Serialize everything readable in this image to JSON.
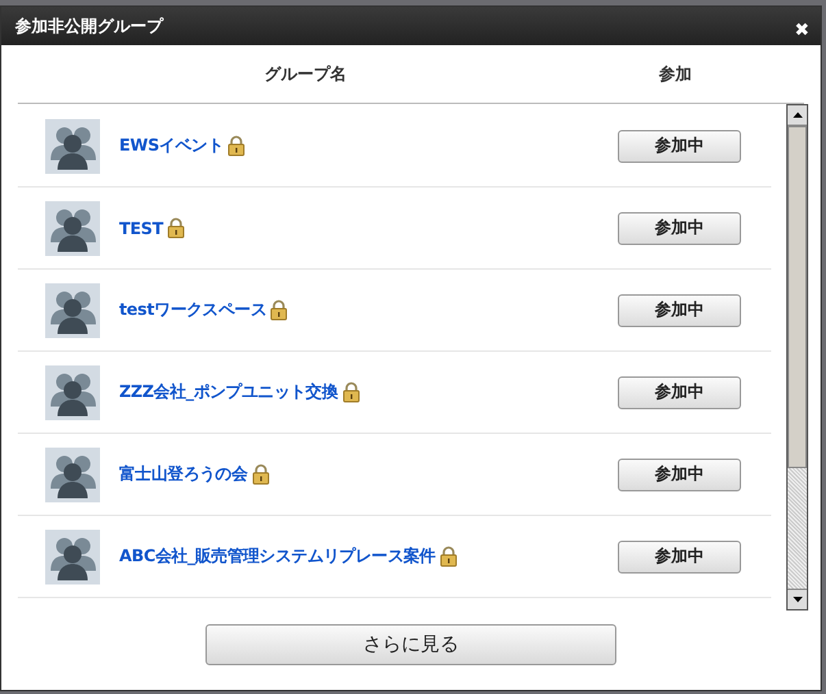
{
  "dialog": {
    "title": "参加非公開グループ",
    "close": "✖"
  },
  "columns": [
    "グループ名",
    "参加"
  ],
  "groups": [
    {
      "name": "EWSイベント",
      "locked": true,
      "button": "参加中"
    },
    {
      "name": "TEST",
      "locked": true,
      "button": "参加中"
    },
    {
      "name": "testワークスペース",
      "locked": true,
      "button": "参加中"
    },
    {
      "name": "ZZZ会社_ポンプユニット交換",
      "locked": true,
      "button": "参加中"
    },
    {
      "name": "富士山登ろうの会",
      "locked": true,
      "button": "参加中"
    },
    {
      "name": "ABC会社_販売管理システムリプレース案件",
      "locked": true,
      "button": "参加中"
    }
  ],
  "more_button": "さらに見る"
}
